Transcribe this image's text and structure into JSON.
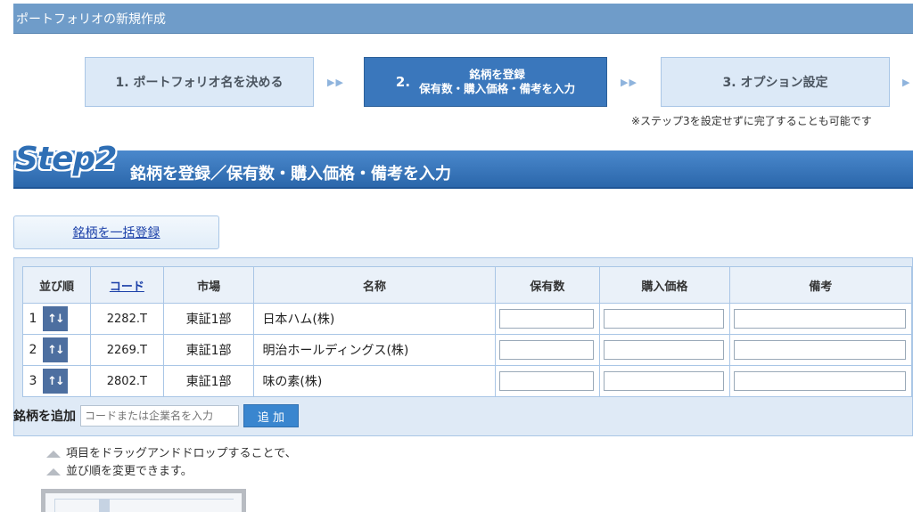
{
  "header": {
    "title": "ポートフォリオの新規作成"
  },
  "steps": [
    {
      "label": "1. ポートフォリオ名を決める"
    },
    {
      "num": "2.",
      "line1": "銘柄を登録",
      "line2": "保有数・購入価格・備考を入力"
    },
    {
      "label": "3. オプション設定"
    }
  ],
  "step_arrows": "▶▶",
  "step_note": "※ステップ3を設定せずに完了することも可能です",
  "step_banner": {
    "logo": "Step2",
    "title": "銘柄を登録／保有数・購入価格・備考を入力"
  },
  "bulk_register_label": "銘柄を一括登録",
  "table": {
    "headers": [
      "並び順",
      "コード",
      "市場",
      "名称",
      "保有数",
      "購入価格",
      "備考"
    ],
    "sort_icon_glyph": "↑↓",
    "rows": [
      {
        "order": "1",
        "code": "2282.T",
        "market": "東証1部",
        "name": "日本ハム(株)"
      },
      {
        "order": "2",
        "code": "2269.T",
        "market": "東証1部",
        "name": "明治ホールディングス(株)"
      },
      {
        "order": "3",
        "code": "2802.T",
        "market": "東証1部",
        "name": "味の素(株)"
      }
    ]
  },
  "add": {
    "label": "銘柄を追加",
    "placeholder": "コードまたは企業名を入力",
    "button": "追 加"
  },
  "hint": {
    "line1": "項目をドラッグアンドドロップすることで、",
    "line2": "並び順を変更できます。"
  }
}
